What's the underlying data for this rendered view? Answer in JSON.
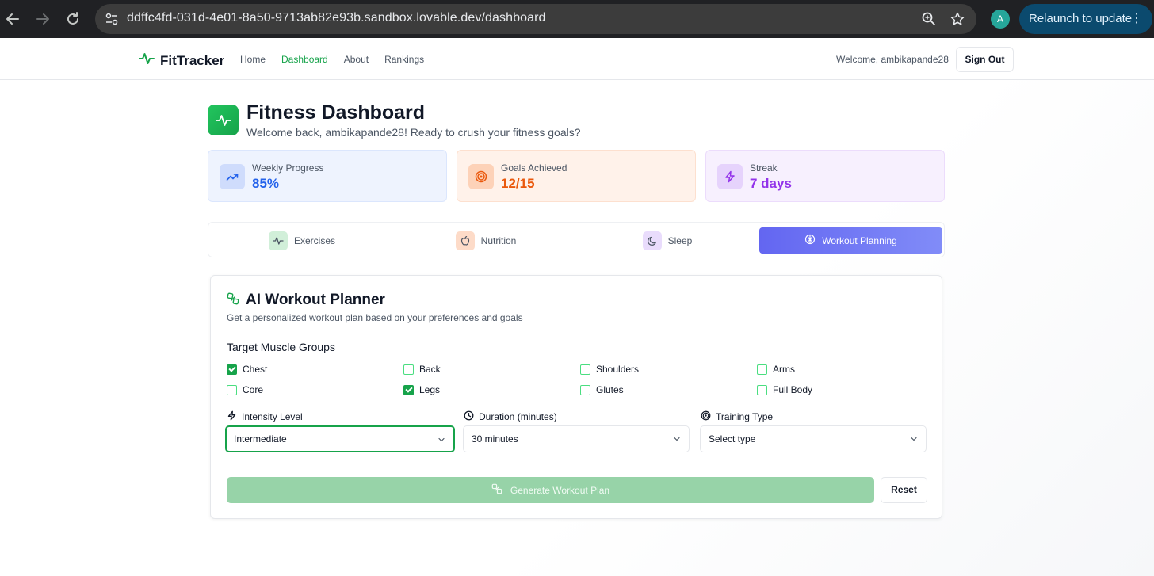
{
  "browser": {
    "url": "ddffc4fd-031d-4e01-8a50-9713ab82e93b.sandbox.lovable.dev/dashboard",
    "profile_initial": "A",
    "relaunch_label": "Relaunch to update",
    "icons": [
      "back-arrow-icon",
      "forward-arrow-icon",
      "reload-icon",
      "site-settings-icon",
      "zoom-icon",
      "bookmark-star-icon",
      "more-vertical-icon"
    ]
  },
  "header": {
    "brand": "FitTracker",
    "nav": [
      "Home",
      "Dashboard",
      "About",
      "Rankings"
    ],
    "active_nav": "Dashboard",
    "welcome": "Welcome, ambikapande28",
    "sign_out": "Sign Out"
  },
  "dashboard": {
    "title": "Fitness Dashboard",
    "subtitle": "Welcome back, ambikapande28! Ready to crush your fitness goals?",
    "stats": [
      {
        "label": "Weekly Progress",
        "value": "85%",
        "icon": "trending-up-icon",
        "color": "#2563eb"
      },
      {
        "label": "Goals Achieved",
        "value": "12/15",
        "icon": "target-icon",
        "color": "#ea580c"
      },
      {
        "label": "Streak",
        "value": "7 days",
        "icon": "zap-icon",
        "color": "#9333ea"
      }
    ]
  },
  "tabs": [
    {
      "label": "Exercises",
      "icon": "activity-icon"
    },
    {
      "label": "Nutrition",
      "icon": "apple-icon"
    },
    {
      "label": "Sleep",
      "icon": "moon-icon"
    },
    {
      "label": "Workout Planning",
      "icon": "brain-icon",
      "active": true
    }
  ],
  "planner": {
    "title": "AI Workout Planner",
    "description": "Get a personalized workout plan based on your preferences and goals",
    "muscle_groups_title": "Target Muscle Groups",
    "muscle_groups": [
      {
        "label": "Chest",
        "checked": true
      },
      {
        "label": "Back",
        "checked": false
      },
      {
        "label": "Shoulders",
        "checked": false
      },
      {
        "label": "Arms",
        "checked": false
      },
      {
        "label": "Core",
        "checked": false
      },
      {
        "label": "Legs",
        "checked": true
      },
      {
        "label": "Glutes",
        "checked": false
      },
      {
        "label": "Full Body",
        "checked": false
      }
    ],
    "intensity": {
      "label": "Intensity Level",
      "value": "Intermediate"
    },
    "duration": {
      "label": "Duration (minutes)",
      "value": "30 minutes"
    },
    "training_type": {
      "label": "Training Type",
      "value": "Select type"
    },
    "generate_label": "Generate Workout Plan",
    "reset_label": "Reset"
  },
  "colors": {
    "brand_green": "#16a34a",
    "active_tab": "#6366f1",
    "generate_disabled": "#97d3a8"
  }
}
